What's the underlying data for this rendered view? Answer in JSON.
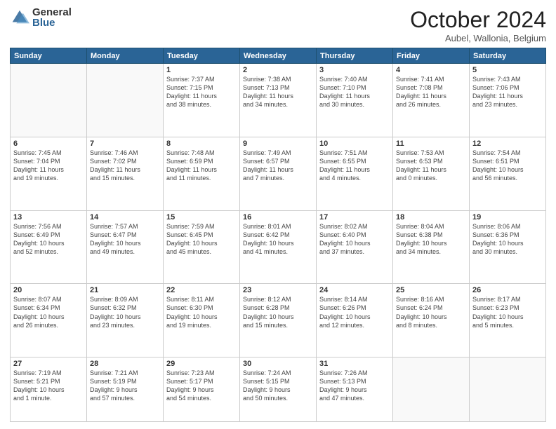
{
  "logo": {
    "general": "General",
    "blue": "Blue"
  },
  "title": {
    "month": "October 2024",
    "location": "Aubel, Wallonia, Belgium"
  },
  "header_days": [
    "Sunday",
    "Monday",
    "Tuesday",
    "Wednesday",
    "Thursday",
    "Friday",
    "Saturday"
  ],
  "weeks": [
    [
      {
        "day": "",
        "info": ""
      },
      {
        "day": "",
        "info": ""
      },
      {
        "day": "1",
        "info": "Sunrise: 7:37 AM\nSunset: 7:15 PM\nDaylight: 11 hours\nand 38 minutes."
      },
      {
        "day": "2",
        "info": "Sunrise: 7:38 AM\nSunset: 7:13 PM\nDaylight: 11 hours\nand 34 minutes."
      },
      {
        "day": "3",
        "info": "Sunrise: 7:40 AM\nSunset: 7:10 PM\nDaylight: 11 hours\nand 30 minutes."
      },
      {
        "day": "4",
        "info": "Sunrise: 7:41 AM\nSunset: 7:08 PM\nDaylight: 11 hours\nand 26 minutes."
      },
      {
        "day": "5",
        "info": "Sunrise: 7:43 AM\nSunset: 7:06 PM\nDaylight: 11 hours\nand 23 minutes."
      }
    ],
    [
      {
        "day": "6",
        "info": "Sunrise: 7:45 AM\nSunset: 7:04 PM\nDaylight: 11 hours\nand 19 minutes."
      },
      {
        "day": "7",
        "info": "Sunrise: 7:46 AM\nSunset: 7:02 PM\nDaylight: 11 hours\nand 15 minutes."
      },
      {
        "day": "8",
        "info": "Sunrise: 7:48 AM\nSunset: 6:59 PM\nDaylight: 11 hours\nand 11 minutes."
      },
      {
        "day": "9",
        "info": "Sunrise: 7:49 AM\nSunset: 6:57 PM\nDaylight: 11 hours\nand 7 minutes."
      },
      {
        "day": "10",
        "info": "Sunrise: 7:51 AM\nSunset: 6:55 PM\nDaylight: 11 hours\nand 4 minutes."
      },
      {
        "day": "11",
        "info": "Sunrise: 7:53 AM\nSunset: 6:53 PM\nDaylight: 11 hours\nand 0 minutes."
      },
      {
        "day": "12",
        "info": "Sunrise: 7:54 AM\nSunset: 6:51 PM\nDaylight: 10 hours\nand 56 minutes."
      }
    ],
    [
      {
        "day": "13",
        "info": "Sunrise: 7:56 AM\nSunset: 6:49 PM\nDaylight: 10 hours\nand 52 minutes."
      },
      {
        "day": "14",
        "info": "Sunrise: 7:57 AM\nSunset: 6:47 PM\nDaylight: 10 hours\nand 49 minutes."
      },
      {
        "day": "15",
        "info": "Sunrise: 7:59 AM\nSunset: 6:45 PM\nDaylight: 10 hours\nand 45 minutes."
      },
      {
        "day": "16",
        "info": "Sunrise: 8:01 AM\nSunset: 6:42 PM\nDaylight: 10 hours\nand 41 minutes."
      },
      {
        "day": "17",
        "info": "Sunrise: 8:02 AM\nSunset: 6:40 PM\nDaylight: 10 hours\nand 37 minutes."
      },
      {
        "day": "18",
        "info": "Sunrise: 8:04 AM\nSunset: 6:38 PM\nDaylight: 10 hours\nand 34 minutes."
      },
      {
        "day": "19",
        "info": "Sunrise: 8:06 AM\nSunset: 6:36 PM\nDaylight: 10 hours\nand 30 minutes."
      }
    ],
    [
      {
        "day": "20",
        "info": "Sunrise: 8:07 AM\nSunset: 6:34 PM\nDaylight: 10 hours\nand 26 minutes."
      },
      {
        "day": "21",
        "info": "Sunrise: 8:09 AM\nSunset: 6:32 PM\nDaylight: 10 hours\nand 23 minutes."
      },
      {
        "day": "22",
        "info": "Sunrise: 8:11 AM\nSunset: 6:30 PM\nDaylight: 10 hours\nand 19 minutes."
      },
      {
        "day": "23",
        "info": "Sunrise: 8:12 AM\nSunset: 6:28 PM\nDaylight: 10 hours\nand 15 minutes."
      },
      {
        "day": "24",
        "info": "Sunrise: 8:14 AM\nSunset: 6:26 PM\nDaylight: 10 hours\nand 12 minutes."
      },
      {
        "day": "25",
        "info": "Sunrise: 8:16 AM\nSunset: 6:24 PM\nDaylight: 10 hours\nand 8 minutes."
      },
      {
        "day": "26",
        "info": "Sunrise: 8:17 AM\nSunset: 6:23 PM\nDaylight: 10 hours\nand 5 minutes."
      }
    ],
    [
      {
        "day": "27",
        "info": "Sunrise: 7:19 AM\nSunset: 5:21 PM\nDaylight: 10 hours\nand 1 minute."
      },
      {
        "day": "28",
        "info": "Sunrise: 7:21 AM\nSunset: 5:19 PM\nDaylight: 9 hours\nand 57 minutes."
      },
      {
        "day": "29",
        "info": "Sunrise: 7:23 AM\nSunset: 5:17 PM\nDaylight: 9 hours\nand 54 minutes."
      },
      {
        "day": "30",
        "info": "Sunrise: 7:24 AM\nSunset: 5:15 PM\nDaylight: 9 hours\nand 50 minutes."
      },
      {
        "day": "31",
        "info": "Sunrise: 7:26 AM\nSunset: 5:13 PM\nDaylight: 9 hours\nand 47 minutes."
      },
      {
        "day": "",
        "info": ""
      },
      {
        "day": "",
        "info": ""
      }
    ]
  ]
}
